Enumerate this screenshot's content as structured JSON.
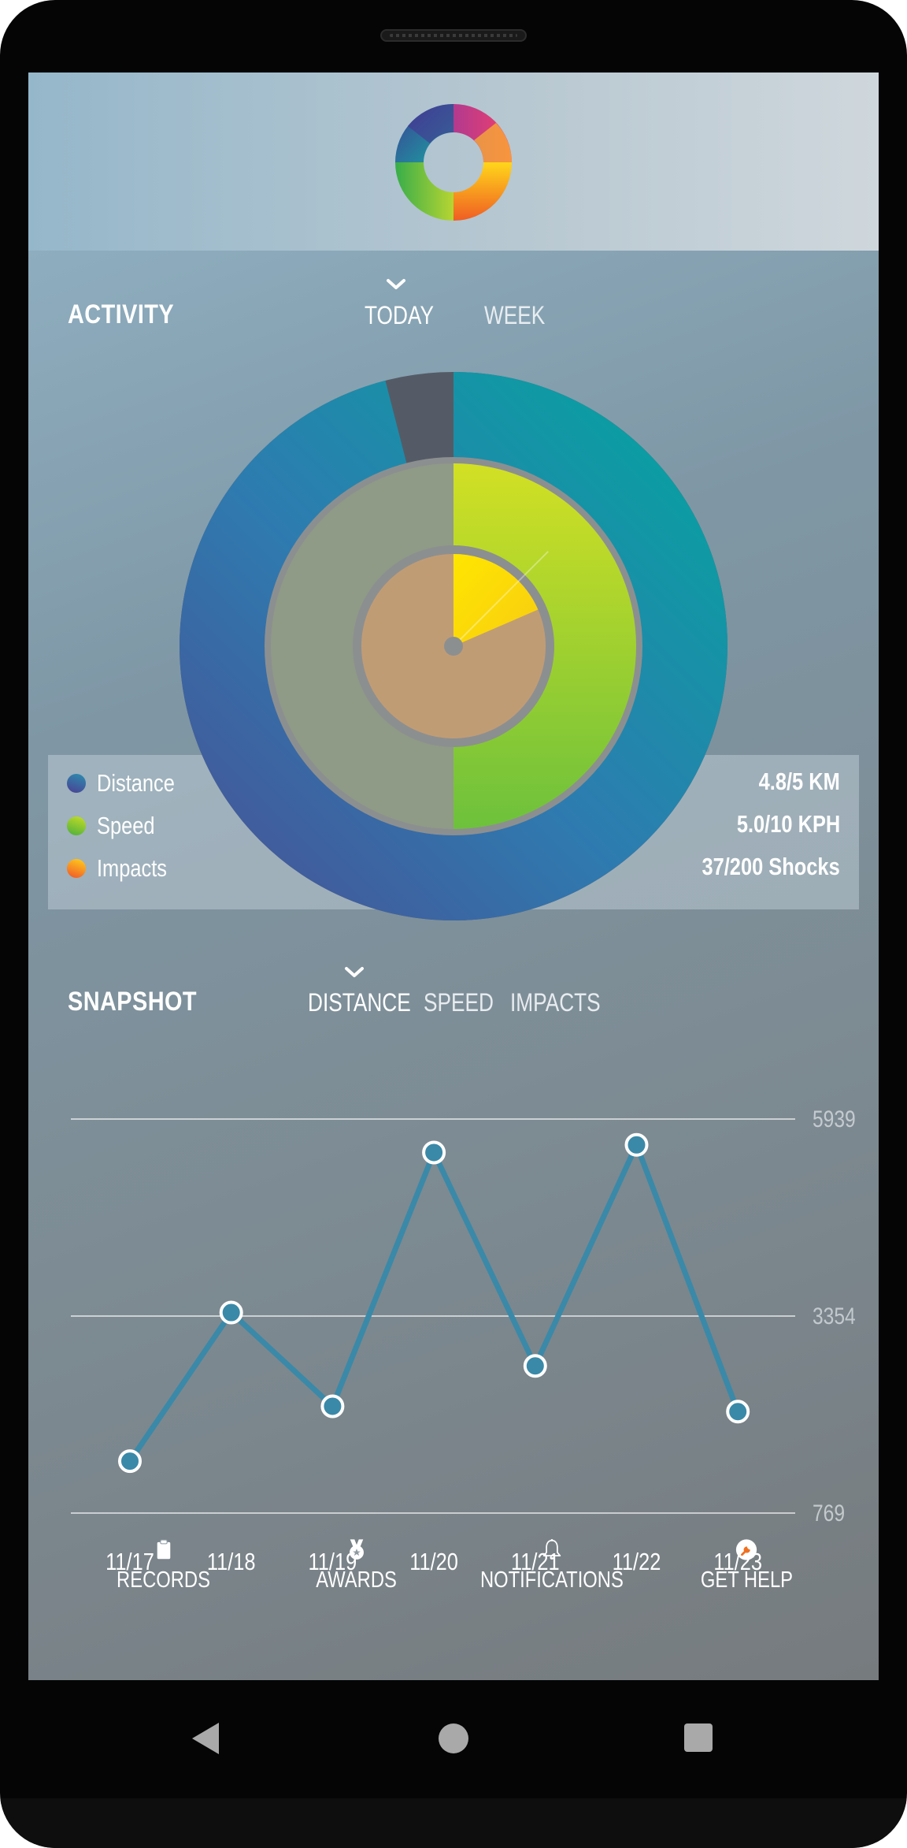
{
  "activity": {
    "title": "ACTIVITY",
    "tabs": [
      {
        "label": "TODAY",
        "selected": true
      },
      {
        "label": "WEEK",
        "selected": false
      }
    ]
  },
  "rings": {
    "distance": {
      "label": "Distance",
      "value_text": "4.8/5 KM",
      "fraction": 0.96,
      "fill_colors": [
        "#00a89e",
        "#2e7bb0",
        "#4a4e93"
      ],
      "remaining_color": "#545b66"
    },
    "speed": {
      "label": "Speed",
      "value_text": "5.0/10 KPH",
      "fraction": 0.5,
      "fill_colors": [
        "#d2e024",
        "#6dc13c"
      ],
      "remaining_color": "#8f9a87"
    },
    "impacts": {
      "label": "Impacts",
      "value_text": "37/200 Shocks",
      "fraction": 0.185,
      "fill_colors": [
        "#ffe600",
        "#f7cc12"
      ],
      "remaining_color": "#c09c75"
    }
  },
  "legend": [
    {
      "key": "distance",
      "label": "Distance",
      "value": "4.8/5 KM",
      "dot_colors": [
        "#2b8fb0",
        "#4b3f94"
      ]
    },
    {
      "key": "speed",
      "label": "Speed",
      "value": "5.0/10 KPH",
      "dot_colors": [
        "#c8de26",
        "#4aae3d"
      ]
    },
    {
      "key": "impacts",
      "label": "Impacts",
      "value": "37/200 Shocks",
      "dot_colors": [
        "#ffd21a",
        "#f0542a"
      ]
    }
  ],
  "snapshot": {
    "title": "SNAPSHOT",
    "tabs": [
      {
        "label": "DISTANCE",
        "selected": true
      },
      {
        "label": "SPEED",
        "selected": false
      },
      {
        "label": "IMPACTS",
        "selected": false
      }
    ]
  },
  "chart_data": {
    "type": "line",
    "x": [
      "11/17",
      "11/18",
      "11/19",
      "11/20",
      "11/21",
      "11/22",
      "11/23"
    ],
    "series": [
      {
        "values": [
          1450,
          3400,
          2170,
          5500,
          2700,
          5600,
          2100
        ]
      }
    ],
    "ylim": [
      769,
      5939
    ],
    "yticks": [
      "5939",
      "3354",
      "769"
    ],
    "grid": true,
    "line_color": "#3a89a8"
  },
  "nav": [
    {
      "label": "RECORDS",
      "icon": "clipboard-icon"
    },
    {
      "label": "AWARDS",
      "icon": "medal-icon"
    },
    {
      "label": "NOTIFICATIONS",
      "icon": "bell-icon"
    },
    {
      "label": "GET HELP",
      "icon": "wrench-icon"
    }
  ],
  "system_nav": [
    "back-icon",
    "home-icon",
    "recents-icon"
  ]
}
